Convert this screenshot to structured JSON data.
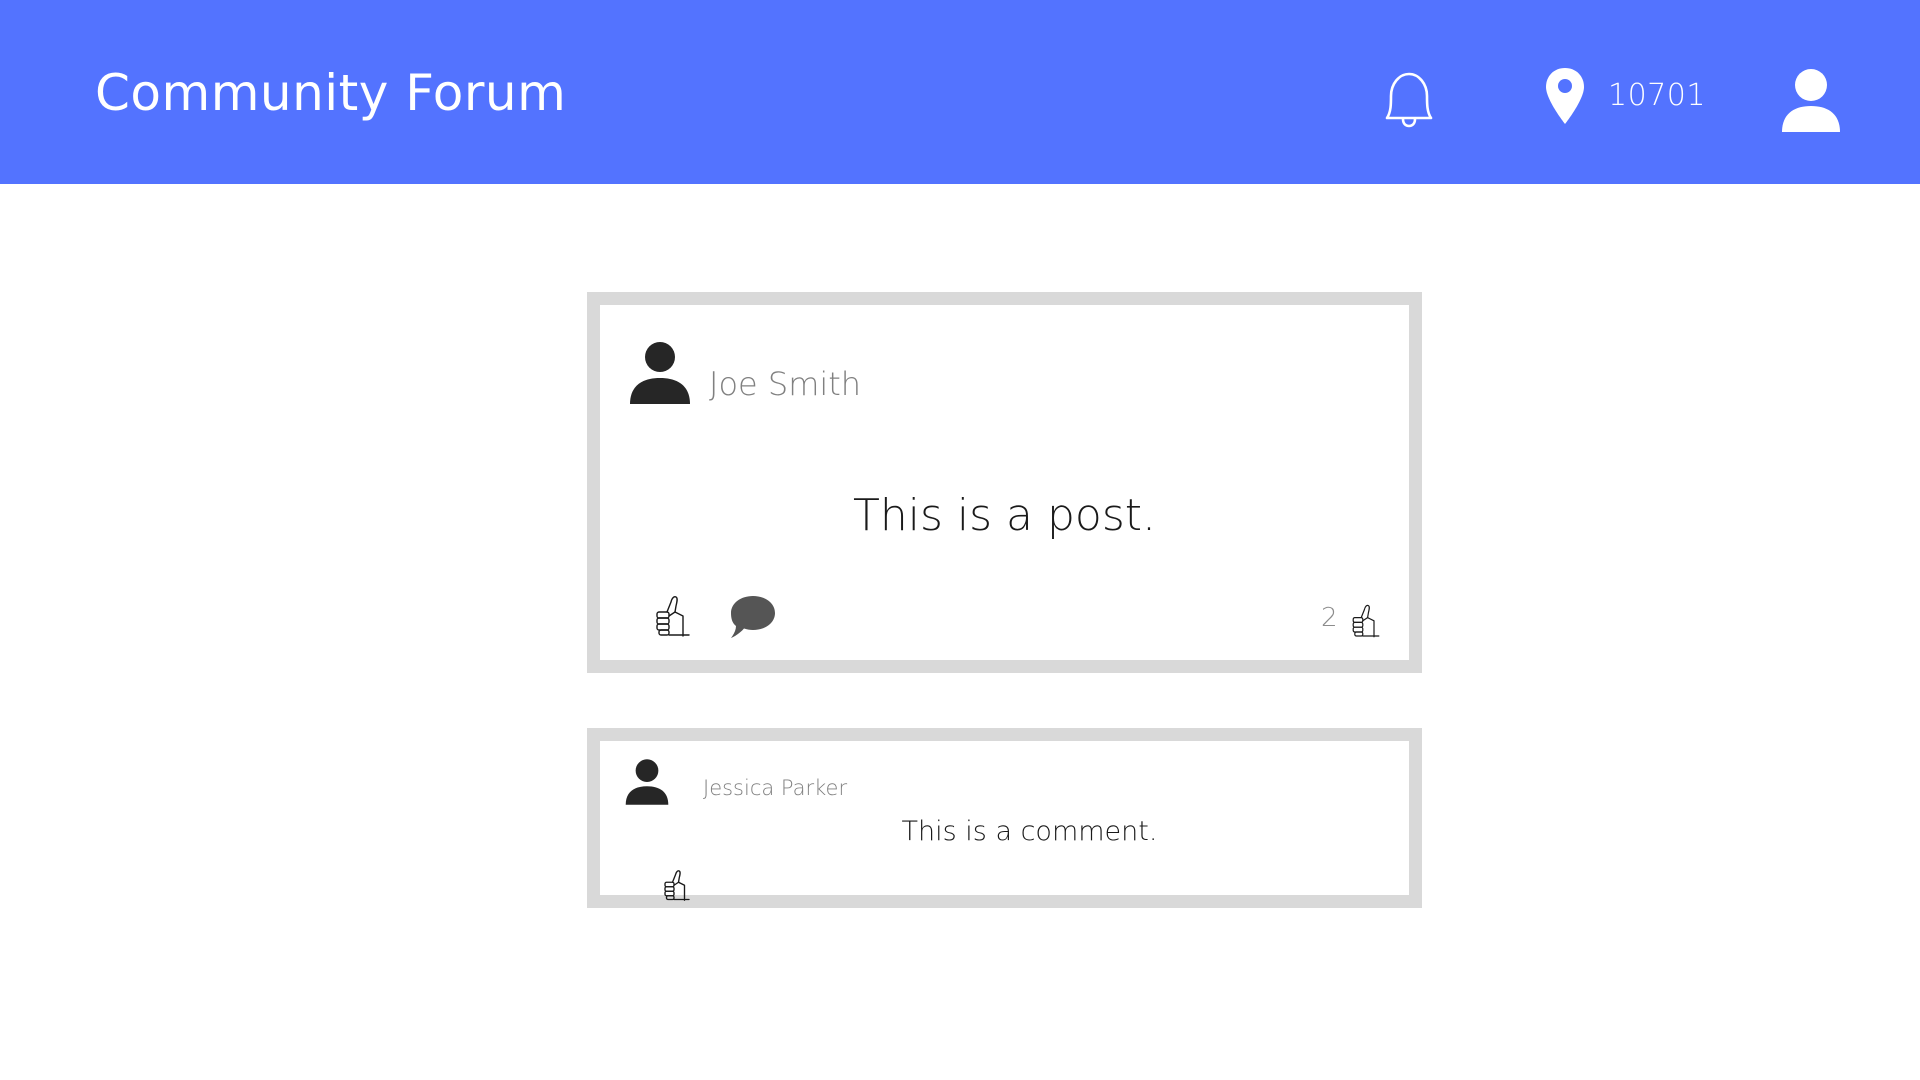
{
  "header": {
    "title": "Community Forum",
    "notifications_icon": "bell-outline-icon",
    "location_icon": "map-pin-icon",
    "location_zip": "10701",
    "account_icon": "user-icon",
    "background_color": "#5373ff",
    "text_color": "#ffffff"
  },
  "post": {
    "author": "Joe Smith",
    "avatar_icon": "user-icon",
    "body": "This is a post.",
    "like_icon": "thumbs-up-icon",
    "comment_icon": "speech-bubble-icon",
    "like_count": "2",
    "border_color": "#d9d9d9"
  },
  "comment": {
    "author": "Jessica Parker",
    "avatar_icon": "user-icon",
    "body": "This is a comment.",
    "like_icon": "thumbs-up-icon",
    "border_color": "#d9d9d9"
  }
}
